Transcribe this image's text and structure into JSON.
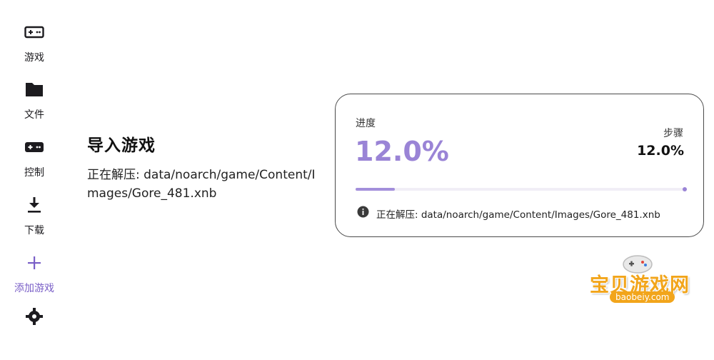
{
  "sidebar": {
    "items": [
      {
        "label": "游戏",
        "icon": "gamepad-icon"
      },
      {
        "label": "文件",
        "icon": "folder-icon"
      },
      {
        "label": "控制",
        "icon": "controller-icon"
      },
      {
        "label": "下载",
        "icon": "download-icon"
      },
      {
        "label": "添加游戏",
        "icon": "plus-icon",
        "active": true
      },
      {
        "label": "",
        "icon": "settings-icon"
      }
    ]
  },
  "main": {
    "title": "导入游戏",
    "detail": "正在解压: data/noarch/game/Content/Images/Gore_481.xnb"
  },
  "card": {
    "progress_label": "进度",
    "progress_value": "12.0%",
    "progress_fraction": 0.12,
    "step_label": "步骤",
    "step_value": "12.0%",
    "info_icon": "info-icon",
    "info_text": "正在解压: data/noarch/game/Content/Images/Gore_481.xnb"
  },
  "watermark": {
    "text": "宝贝游戏网",
    "url": "baobeiy.com"
  },
  "colors": {
    "accent": "#9a84d6",
    "bar_fill": "#a38fdb",
    "bar_track": "#f1eef6",
    "card_border": "#4a4a4a",
    "watermark": "#f2a51b"
  }
}
